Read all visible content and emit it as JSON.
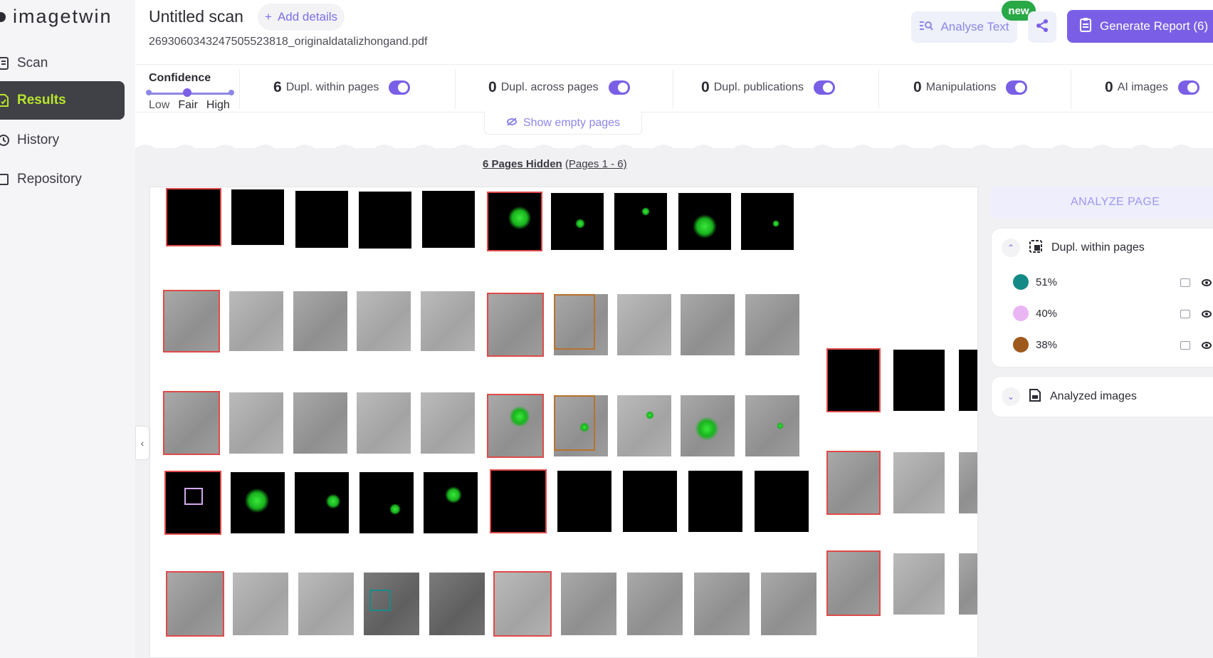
{
  "app": {
    "logo_text": "imagetwin"
  },
  "sidebar": {
    "items": [
      {
        "label": "Scan",
        "icon": "scan-icon",
        "active": false
      },
      {
        "label": "Results",
        "icon": "results-icon",
        "active": true
      },
      {
        "label": "History",
        "icon": "history-icon",
        "active": false
      },
      {
        "label": "Repository",
        "icon": "repository-icon",
        "active": false
      }
    ]
  },
  "header": {
    "title": "Untitled scan",
    "add_details": "Add details",
    "filename": "2693060343247505523818_originaldatalizhongand.pdf",
    "analyse_text": "Analyse Text",
    "new_badge": "new",
    "generate_report": "Generate Report (6)"
  },
  "stats": {
    "confidence_label": "Confidence",
    "confidence_levels": [
      "Low",
      "Fair",
      "High"
    ],
    "confidence_selected": "Fair",
    "items": [
      {
        "count": "6",
        "label": "Dupl. within pages",
        "enabled": true
      },
      {
        "count": "0",
        "label": "Dupl. across pages",
        "enabled": true
      },
      {
        "count": "0",
        "label": "Dupl. publications",
        "enabled": true
      },
      {
        "count": "0",
        "label": "Manipulations",
        "enabled": true
      },
      {
        "count": "0",
        "label": "AI images",
        "enabled": true
      }
    ],
    "show_empty": "Show empty pages"
  },
  "pages": {
    "hidden_count_text": "6 Pages Hidden",
    "hidden_range_text": "(Pages 1 - 6)"
  },
  "panel": {
    "analyze_page": "ANALYZE PAGE",
    "section1_title": "Dupl. within pages",
    "matches": [
      {
        "value": "51%",
        "color": "#138a86"
      },
      {
        "value": "40%",
        "color": "#e9b6f3"
      },
      {
        "value": "38%",
        "color": "#a0591d"
      }
    ],
    "section2_title": "Analyzed images"
  },
  "colors": {
    "accent": "#7a5fe6",
    "active_nav_text": "#b9e52c",
    "active_nav_bg": "#3f4147",
    "new_badge": "#29a846",
    "duplicate_outline": "#e04a4a"
  }
}
